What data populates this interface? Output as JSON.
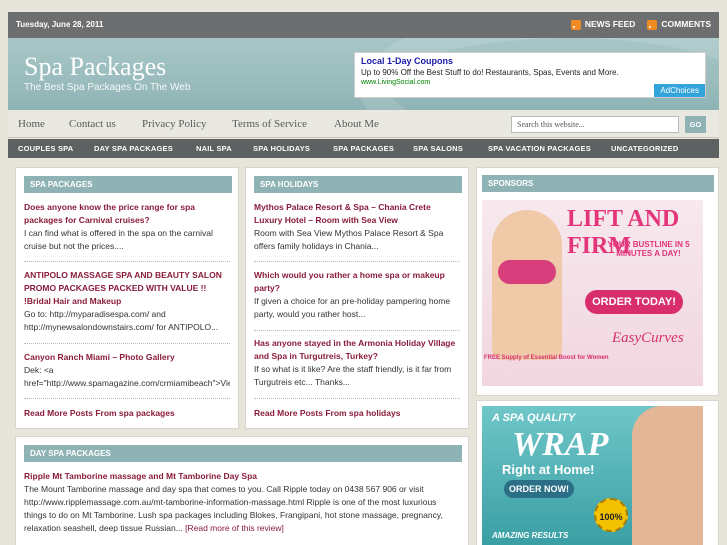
{
  "topbar": {
    "date": "Tuesday, June 28, 2011",
    "news_feed": "NEWS FEED",
    "comments": "COMMENTS"
  },
  "header": {
    "title": "Spa Packages",
    "tagline": "The Best Spa Packages On The Web",
    "ad": {
      "title": "Local 1-Day Coupons",
      "body": "Up to 90% Off the Best Stuff to do! Restaurants, Spas, Events and More.",
      "url": "www.LivingSocial.com",
      "adchoices": "AdChoices"
    }
  },
  "nav": {
    "items": [
      "Home",
      "Contact us",
      "Privacy Policy",
      "Terms of Service",
      "About Me"
    ],
    "search_placeholder": "Search this website...",
    "go": "GO"
  },
  "categories": [
    "COUPLES SPA",
    "DAY SPA PACKAGES",
    "NAIL SPA",
    "SPA HOLIDAYS",
    "SPA PACKAGES",
    "SPA SALONS",
    "SPA VACATION PACKAGES",
    "UNCATEGORIZED"
  ],
  "spa_packages": {
    "heading": "SPA PACKAGES",
    "posts": [
      {
        "title": "Does anyone know the price range for spa packages for Carnival cruises?",
        "excerpt": "I can find what is offered in the spa on the carnival cruise but not the prices...."
      },
      {
        "title": "ANTIPOLO MASSAGE SPA AND BEAUTY SALON PROMO PACKAGES PACKED WITH VALUE !! !Bridal Hair and Makeup",
        "excerpt": "Go to: http://myparadisespa.com/ and http://mynewsalondownstairs.com/ for ANTIPOLO..."
      },
      {
        "title": "Canyon Ranch Miami – Photo Gallery",
        "excerpt_1": "Dek: <a",
        "excerpt_2": "href=\"http://www.spamagazine.com/crmiamibeach\">View"
      }
    ],
    "more": "Read More Posts From spa packages"
  },
  "spa_holidays": {
    "heading": "SPA HOLIDAYS",
    "posts": [
      {
        "title": "Mythos Palace Resort & Spa – Chania Crete Luxury Hotel – Room with Sea View",
        "excerpt": "Room with Sea View Mythos Palace Resort & Spa offers family holidays in Chania..."
      },
      {
        "title": "Which would you rather a home spa or makeup party?",
        "excerpt": "If given a choice for an pre-holiday pampering home party, would you rather host..."
      },
      {
        "title": "Has anyone stayed in the Armonia Holiday Village and Spa in Turgutreis, Turkey?",
        "excerpt": "If so what is it like? Are the staff friendly, is it far from Turgutreis etc... Thanks..."
      }
    ],
    "more": "Read More Posts From spa holidays"
  },
  "day_spa": {
    "heading": "DAY SPA PACKAGES",
    "post": {
      "title": "Ripple Mt Tamborine massage and Mt Tamborine Day Spa",
      "excerpt": "The Mount Tamborine massage and day spa that comes to you. Call Ripple today on 0438 567 906 or visit http://www.ripplemassage.com.au/mt-tamborine-information-massage.html Ripple is one of the most luxurious things to do on Mt Tamborine. Lush spa packages including Blokes, Frangipani, hot stone massage, pregnancy, relaxation seashell, deep tissue Russian...",
      "read_more": "[Read more of this review]"
    }
  },
  "sponsors": {
    "heading": "SPONSORS",
    "ad1": {
      "headline": "LIFT AND FIRM",
      "subline": "YOUR BUSTLINE IN 5 MINUTES A DAY!",
      "button": "ORDER TODAY!",
      "brand": "EasyCurves",
      "free": "FREE Supply of Essential Boost for Women"
    },
    "ad2": {
      "line1": "A SPA QUALITY",
      "line2": "WRAP",
      "line3": "Right at Home!",
      "button": "ORDER NOW!",
      "seal": "100%",
      "bottom": "AMAZING RESULTS"
    }
  }
}
